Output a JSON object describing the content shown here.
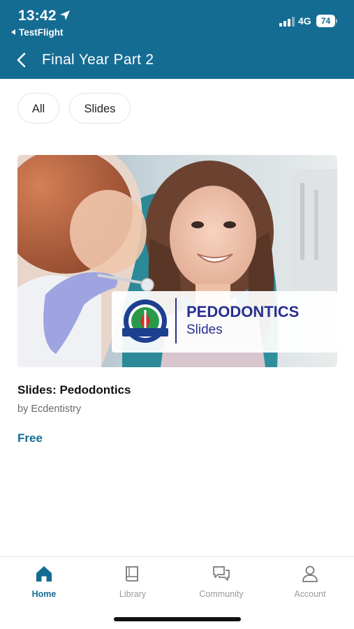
{
  "status_bar": {
    "time": "13:42",
    "back_app": "TestFlight",
    "network": "4G",
    "battery": "74"
  },
  "header": {
    "title": "Final Year Part 2"
  },
  "filters": [
    {
      "label": "All"
    },
    {
      "label": "Slides"
    }
  ],
  "course": {
    "banner_title": "PEDODONTICS",
    "banner_subtitle": "Slides",
    "title": "Slides: Pedodontics",
    "author": "by Ecdentistry",
    "price": "Free"
  },
  "bottom_nav": [
    {
      "label": "Home",
      "icon": "home-icon",
      "active": true
    },
    {
      "label": "Library",
      "icon": "book-icon",
      "active": false
    },
    {
      "label": "Community",
      "icon": "chat-bubbles-icon",
      "active": false
    },
    {
      "label": "Account",
      "icon": "person-icon",
      "active": false
    }
  ],
  "colors": {
    "primary": "#146c93",
    "banner_text": "#2a2f8f"
  }
}
